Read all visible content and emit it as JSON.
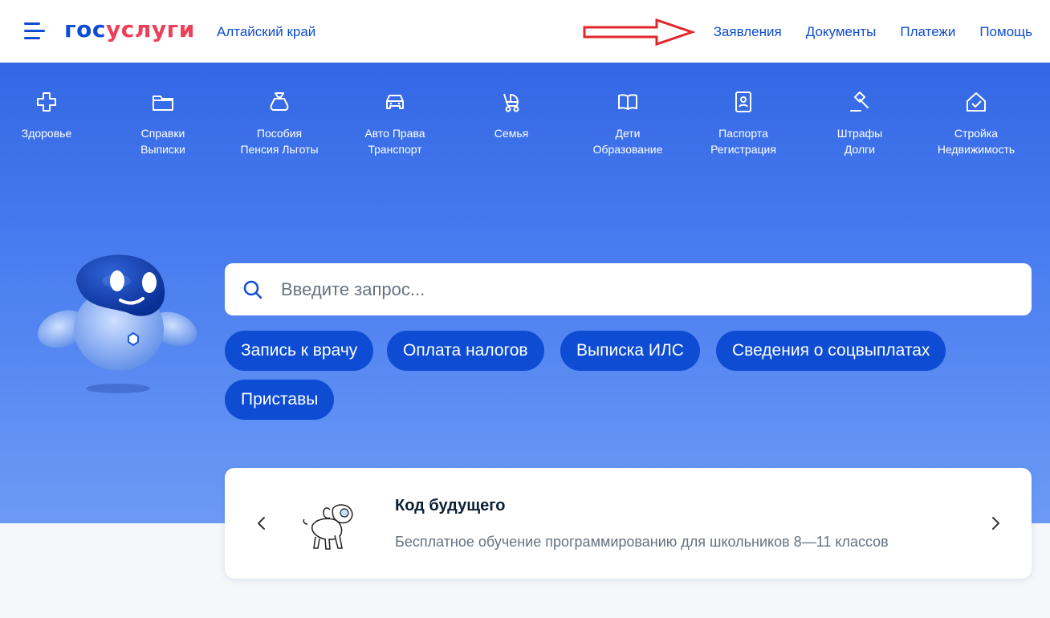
{
  "header": {
    "logo_part1": "гос",
    "logo_part2": "услуги",
    "region": "Алтайский край",
    "nav": [
      "Заявления",
      "Документы",
      "Платежи",
      "Помощь"
    ]
  },
  "categories": [
    {
      "line1": "Здоровье",
      "line2": "",
      "icon": "health-cross-icon"
    },
    {
      "line1": "Справки",
      "line2": "Выписки",
      "icon": "folder-icon"
    },
    {
      "line1": "Пособия",
      "line2": "Пенсия Льготы",
      "icon": "money-bag-icon"
    },
    {
      "line1": "Авто Права",
      "line2": "Транспорт",
      "icon": "car-icon"
    },
    {
      "line1": "Семья",
      "line2": "",
      "icon": "stroller-icon"
    },
    {
      "line1": "Дети",
      "line2": "Образование",
      "icon": "book-icon"
    },
    {
      "line1": "Паспорта",
      "line2": "Регистрация",
      "icon": "passport-icon"
    },
    {
      "line1": "Штрафы",
      "line2": "Долги",
      "icon": "gavel-icon"
    },
    {
      "line1": "Стройка",
      "line2": "Недвижимость",
      "icon": "house-icon"
    }
  ],
  "search": {
    "placeholder": "Введите запрос..."
  },
  "chips": [
    "Запись к врачу",
    "Оплата налогов",
    "Выписка ИЛС",
    "Сведения о соцвыплатах",
    "Приставы"
  ],
  "promo": {
    "title": "Код будущего",
    "description": "Бесплатное обучение программированию для школьников 8—11 классов"
  },
  "colors": {
    "brand_blue": "#0d4cd3",
    "brand_red": "#ee3f58",
    "hero_top": "#3367e4",
    "hero_bottom": "#6c9bf5",
    "annotation_arrow": "#e3262b"
  }
}
